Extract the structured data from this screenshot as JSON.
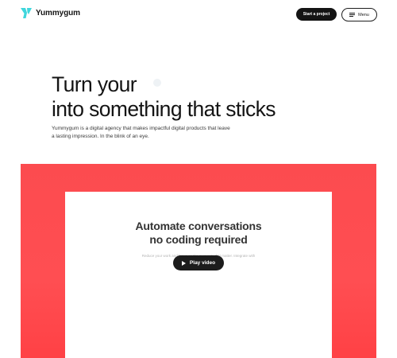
{
  "header": {
    "brand": "Yummygum",
    "logo_icon": "yummygum-logo-icon",
    "cta_label": "Start a project",
    "menu_label": "Menu",
    "menu_icon": "hamburger-icon"
  },
  "hero": {
    "title_line1": "Turn your",
    "title_line2": "into something that sticks",
    "subtitle": "Yummygum is a digital agency that makes impactful digital products that leave a lasting impression. In the blink of an eye."
  },
  "showcase": {
    "card_title_line1": "Automate conversations",
    "card_title_line2": "no coding required",
    "card_subtitle": "Reduce your work and focus on the moments that matter. Integrate with the tools you already use.",
    "play_label": "Play video",
    "play_icon": "play-icon"
  },
  "colors": {
    "accent_red": "#ff4b4f",
    "dark": "#141414",
    "logo_cyan": "#3fd6dc"
  }
}
